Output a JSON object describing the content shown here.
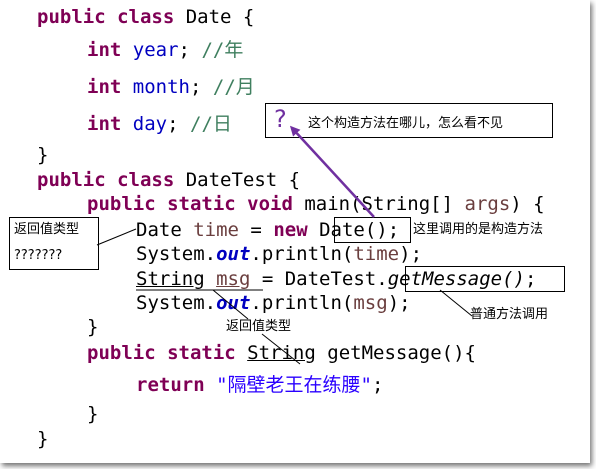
{
  "code_lines": {
    "l1": {
      "kw": "public class",
      "rest": " Date {"
    },
    "l2": {
      "kw": "int",
      "field": "year",
      "semi": ";",
      "comment": "//年"
    },
    "l3": {
      "kw": "int",
      "field": "month",
      "semi": ";",
      "comment": "//月"
    },
    "l4": {
      "kw": "int",
      "field": "day",
      "semi": ";",
      "comment": "//日"
    },
    "l5": {
      "text": "}"
    },
    "l6": {
      "kw": "public class",
      "rest": " DateTest {"
    },
    "l7": {
      "kw": "public static void",
      "rest": " main(String[] ",
      "param": "args",
      "end": ") {"
    },
    "l8": {
      "type": "Date",
      "var": "time",
      "eq": " = ",
      "kw": "new",
      "call": "Date()",
      "end": ";"
    },
    "l9": {
      "pre": "System.",
      "out": "out",
      "mid": ".println(",
      "arg": "time",
      "end": ");"
    },
    "l10": {
      "type": "String",
      "var": "msg",
      "mid": " = DateTest.",
      "call": "getMessage()",
      "end": ";"
    },
    "l11": {
      "pre": "System.",
      "out": "out",
      "mid": ".println(",
      "arg": "msg",
      "end": ");"
    },
    "l12": {
      "text": "}"
    },
    "l13": {
      "kw": "public static",
      "type": "String",
      "rest": " getMessage(){"
    },
    "l14": {
      "kw": "return",
      "str": "\"隔壁老王在练腰\"",
      "end": ";"
    },
    "l15": {
      "text": "}"
    },
    "l16": {
      "text": "}"
    }
  },
  "annotations": {
    "question_mark": "?",
    "question_text": "这个构造方法在哪儿，怎么看不见",
    "constructor_call_note": "这里调用的是构造方法",
    "return_type_box_title": "返回值类型",
    "return_type_box_value": "???????",
    "return_type_note": "返回值类型",
    "normal_method_note": "普通方法调用"
  },
  "colors": {
    "keyword": "#7f0055",
    "field": "#0000c0",
    "comment": "#3f7f5f",
    "string": "#2a00ff",
    "arrow": "#7030a0"
  }
}
